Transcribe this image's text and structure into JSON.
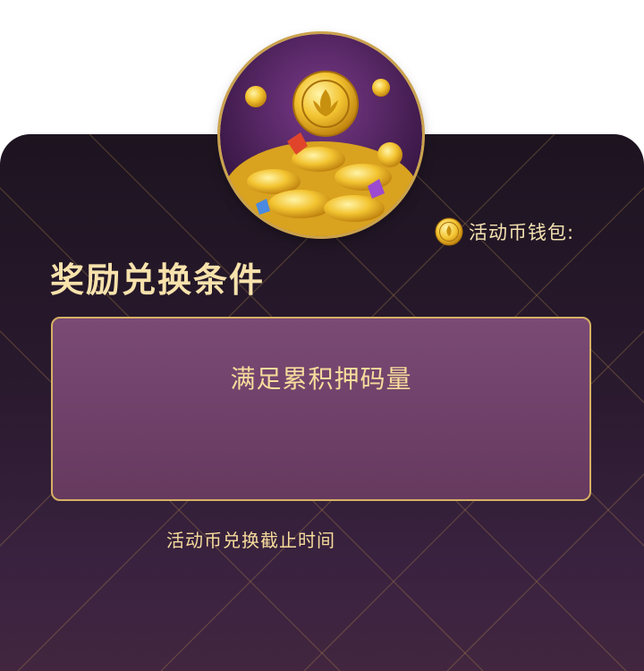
{
  "header": {
    "wallet_label": "活动币钱包:",
    "wallet_icon": "gold-coin-icon",
    "hero_image": "coin-pile-illustration"
  },
  "main": {
    "section_title": "奖励兑换条件",
    "condition_text": "满足累积押码量",
    "deadline_label": "活动币兑换截止时间"
  },
  "colors": {
    "gold_text": "#f6dc9c",
    "panel_dark": "#1e1522",
    "box_purple": "#7a4a75",
    "border_gold": "#d6b064"
  }
}
